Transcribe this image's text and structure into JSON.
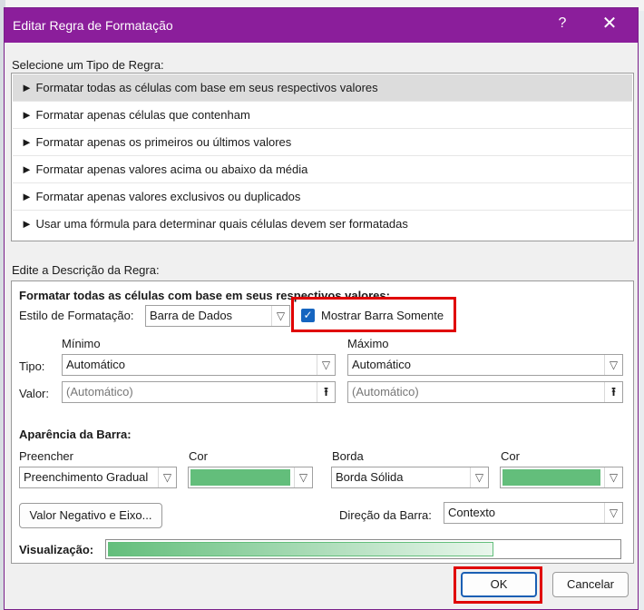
{
  "dialog": {
    "title": "Editar Regra de Formatação",
    "help": "?",
    "close": "✕"
  },
  "rule_type": {
    "label": "Selecione um Tipo de Regra:",
    "items": [
      "► Formatar todas as células com base em seus respectivos valores",
      "► Formatar apenas células que contenham",
      "► Formatar apenas os primeiros ou últimos valores",
      "► Formatar apenas valores acima ou abaixo da média",
      "► Formatar apenas valores exclusivos ou duplicados",
      "► Usar uma fórmula para determinar quais células devem ser formatadas"
    ],
    "selected_index": 0
  },
  "description": {
    "label": "Edite a Descrição da Regra:",
    "heading": "Formatar todas as células com base em seus respectivos valores:",
    "style_label": "Estilo de Formatação:",
    "style_value": "Barra de Dados",
    "show_bar_only_label": "Mostrar Barra Somente",
    "show_bar_only_checked": true,
    "min_label": "Mínimo",
    "max_label": "Máximo",
    "type_label": "Tipo:",
    "value_label": "Valor:",
    "min_type": "Automático",
    "max_type": "Automático",
    "min_value": "(Automático)",
    "max_value": "(Automático)"
  },
  "bar_appearance": {
    "heading": "Aparência da Barra:",
    "fill_label": "Preencher",
    "fill_color_label": "Cor",
    "border_label": "Borda",
    "border_color_label": "Cor",
    "fill_value": "Preenchimento Gradual",
    "border_value": "Borda Sólida",
    "fill_color": "#63be7b",
    "border_color": "#63be7b",
    "negative_axis_button": "Valor Negativo e Eixo...",
    "direction_label": "Direção da Barra:",
    "direction_value": "Contexto",
    "preview_label": "Visualização:"
  },
  "buttons": {
    "ok": "OK",
    "cancel": "Cancelar"
  },
  "icons": {
    "dropdown": "▽",
    "range_select": "⭱",
    "rule_bullet": "►",
    "check": "✓"
  }
}
